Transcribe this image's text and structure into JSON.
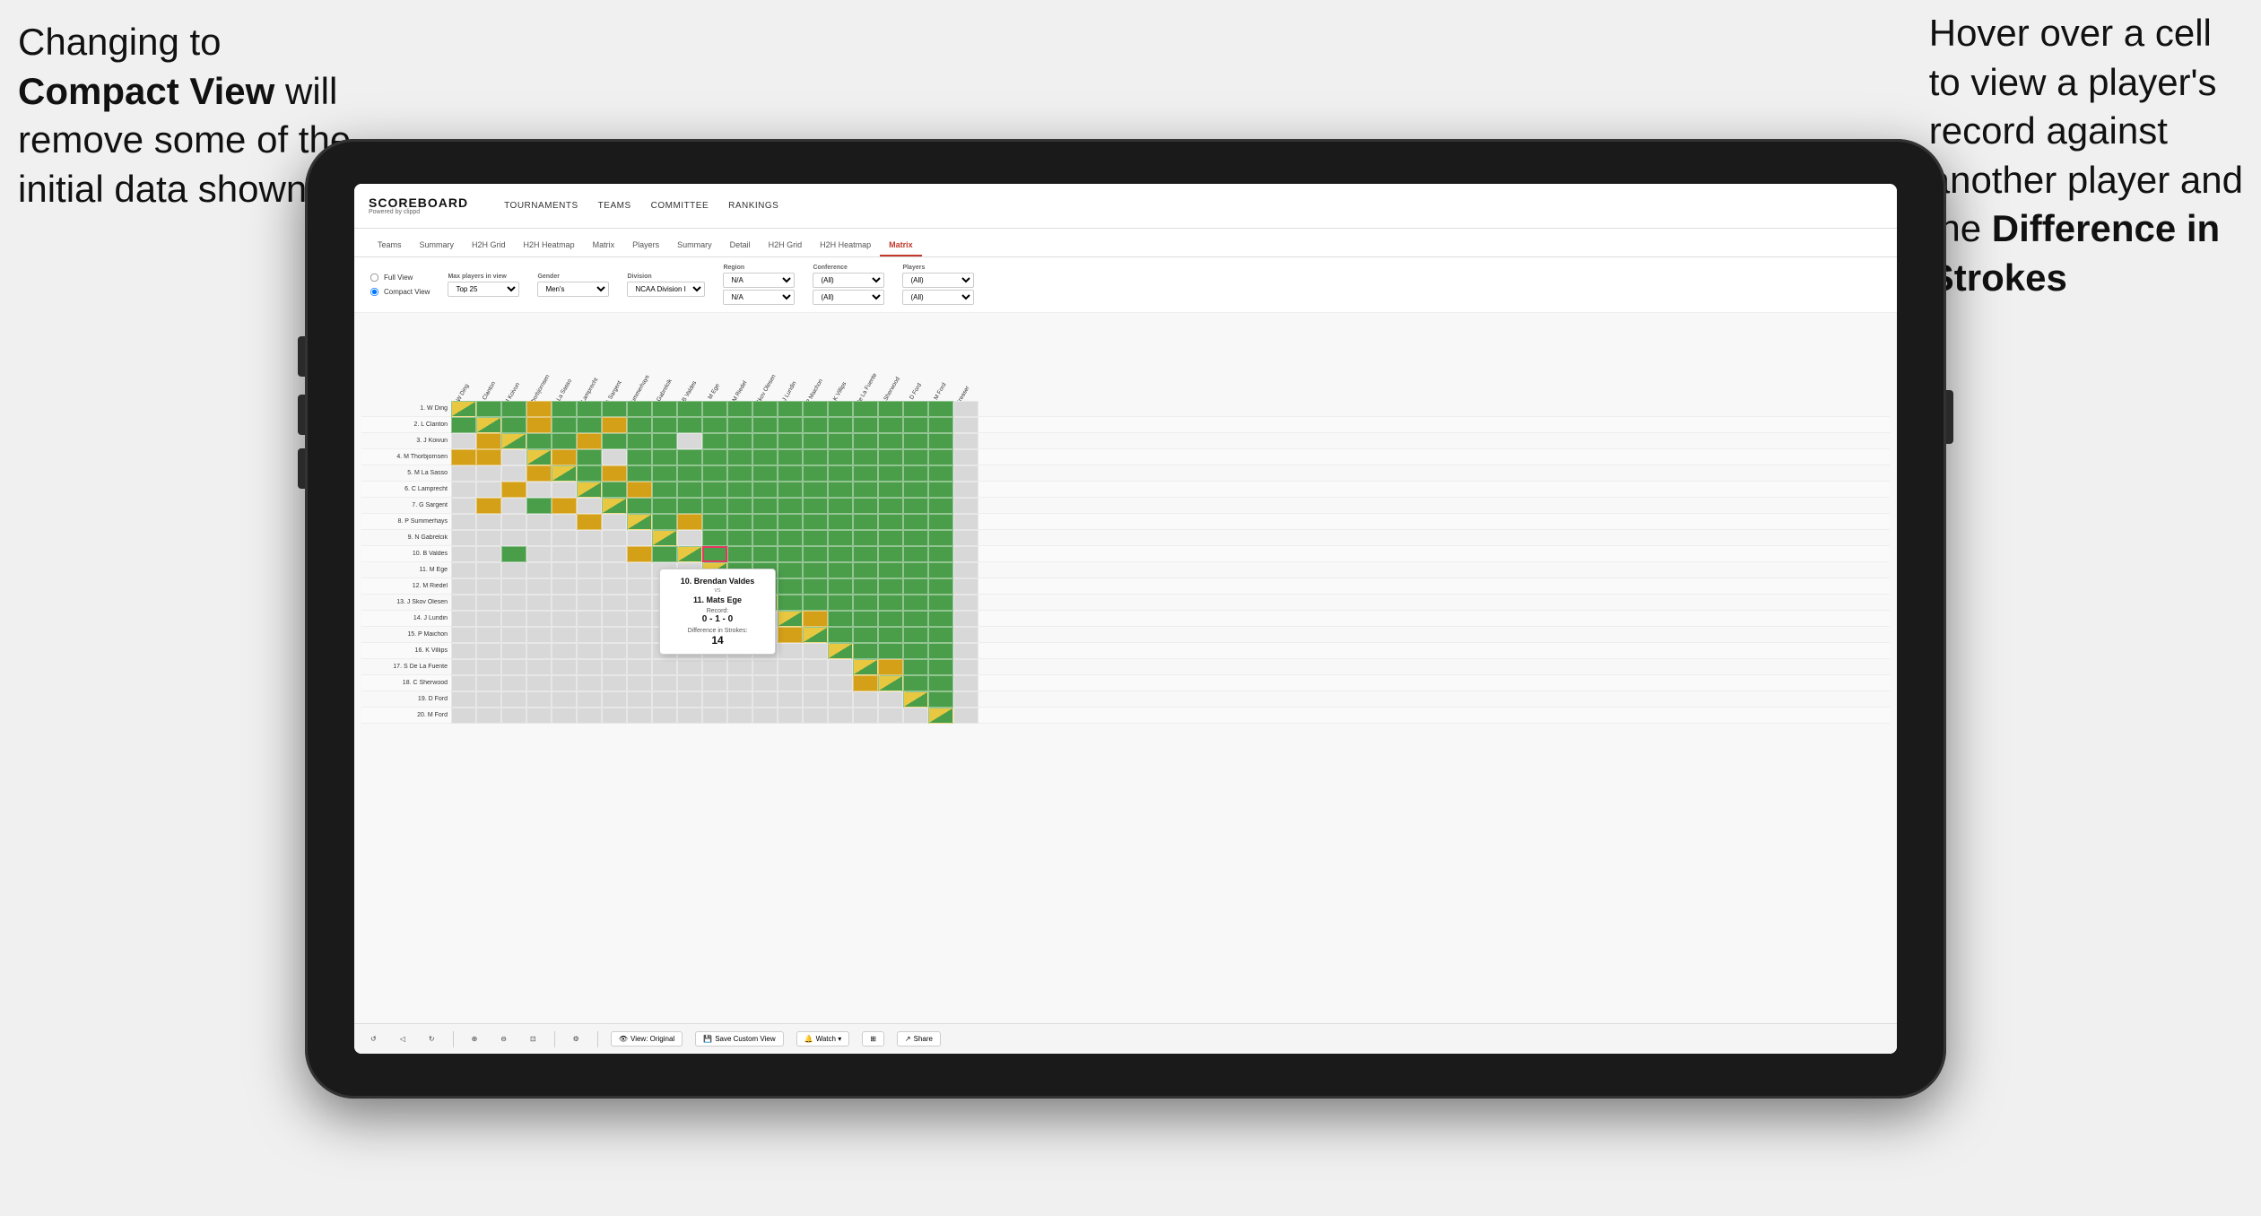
{
  "annotations": {
    "left": {
      "line1": "Changing to",
      "line2_bold": "Compact View",
      "line2_rest": " will",
      "line3": "remove some of the",
      "line4": "initial data shown"
    },
    "right": {
      "line1": "Hover over a cell",
      "line2": "to view a player's",
      "line3": "record against",
      "line4": "another player and",
      "line5_prefix": "the ",
      "line5_bold": "Difference in",
      "line6_bold": "Strokes"
    }
  },
  "nav": {
    "logo_main": "SCOREBOARD",
    "logo_sub": "Powered by clippd",
    "links": [
      "TOURNAMENTS",
      "TEAMS",
      "COMMITTEE",
      "RANKINGS"
    ]
  },
  "sub_nav": {
    "tabs": [
      "Teams",
      "Summary",
      "H2H Grid",
      "H2H Heatmap",
      "Matrix",
      "Players",
      "Summary",
      "Detail",
      "H2H Grid",
      "H2H Heatmap",
      "Matrix"
    ],
    "active_index": 10
  },
  "filters": {
    "view_options": [
      "Full View",
      "Compact View"
    ],
    "selected_view": "Compact View",
    "max_players_label": "Max players in view",
    "max_players_value": "Top 25",
    "gender_label": "Gender",
    "gender_value": "Men's",
    "division_label": "Division",
    "division_value": "NCAA Division I",
    "region_label": "Region",
    "region_values": [
      "N/A",
      "N/A"
    ],
    "conference_label": "Conference",
    "conference_values": [
      "(All)",
      "(All)"
    ],
    "players_label": "Players",
    "players_values": [
      "(All)",
      "(All)"
    ]
  },
  "matrix": {
    "col_headers": [
      "1. W Ding",
      "2. L Clanton",
      "3. J Koivun",
      "4. M Thorbjornsen",
      "5. M La Sasso",
      "6. C Lamprecht",
      "7. G Sargent",
      "8. P Summerhays",
      "9. N Gabrelcik",
      "10. B Valdes",
      "11. M Ege",
      "12. M Riedel",
      "13. J Skov Olesen",
      "14. J Lundin",
      "15. P Maichon",
      "16. K Villips",
      "17. S De La Fuente",
      "18. C Sherwood",
      "19. D Ford",
      "20. M Ford",
      "..."
    ],
    "rows": [
      {
        "label": "1. W Ding",
        "cells": [
          "",
          "G",
          "G",
          "Y",
          "G",
          "G",
          "G",
          "G",
          "G",
          "G",
          "G",
          "G",
          "G",
          "G",
          "G",
          "G",
          "G",
          "G",
          "G",
          "G"
        ]
      },
      {
        "label": "2. L Clanton",
        "cells": [
          "G",
          "",
          "G",
          "Y",
          "G",
          "G",
          "Y",
          "G",
          "G",
          "G",
          "G",
          "G",
          "G",
          "G",
          "G",
          "G",
          "G",
          "G",
          "G",
          "G"
        ]
      },
      {
        "label": "3. J Koivun",
        "cells": [
          "LG",
          "Y",
          "",
          "G",
          "G",
          "Y",
          "G",
          "G",
          "G",
          "LG",
          "G",
          "G",
          "G",
          "G",
          "G",
          "G",
          "G",
          "G",
          "G",
          "G"
        ]
      },
      {
        "label": "4. M Thorbjornsen",
        "cells": [
          "Y",
          "Y",
          "LG",
          "",
          "Y",
          "G",
          "LG",
          "G",
          "G",
          "G",
          "G",
          "G",
          "G",
          "G",
          "G",
          "G",
          "G",
          "G",
          "G",
          "G"
        ]
      },
      {
        "label": "5. M La Sasso",
        "cells": [
          "LG",
          "LG",
          "LG",
          "Y",
          "",
          "G",
          "Y",
          "G",
          "G",
          "G",
          "G",
          "G",
          "G",
          "G",
          "G",
          "G",
          "G",
          "G",
          "G",
          "G"
        ]
      },
      {
        "label": "6. C Lamprecht",
        "cells": [
          "LG",
          "LG",
          "Y",
          "LG",
          "LG",
          "",
          "G",
          "Y",
          "G",
          "G",
          "G",
          "G",
          "G",
          "G",
          "G",
          "G",
          "G",
          "G",
          "G",
          "G"
        ]
      },
      {
        "label": "7. G Sargent",
        "cells": [
          "LG",
          "Y",
          "LG",
          "G",
          "Y",
          "LG",
          "",
          "G",
          "G",
          "G",
          "G",
          "G",
          "G",
          "G",
          "G",
          "G",
          "G",
          "G",
          "G",
          "G"
        ]
      },
      {
        "label": "8. P Summerhays",
        "cells": [
          "LG",
          "LG",
          "LG",
          "LG",
          "LG",
          "Y",
          "LG",
          "",
          "G",
          "Y",
          "G",
          "G",
          "G",
          "G",
          "G",
          "G",
          "G",
          "G",
          "G",
          "G"
        ]
      },
      {
        "label": "9. N Gabrelcik",
        "cells": [
          "LG",
          "LG",
          "LG",
          "LG",
          "LG",
          "LG",
          "LG",
          "LG",
          "",
          "LG",
          "G",
          "G",
          "G",
          "G",
          "G",
          "G",
          "G",
          "G",
          "G",
          "G"
        ]
      },
      {
        "label": "10. B Valdes",
        "cells": [
          "LG",
          "LG",
          "G",
          "LG",
          "LG",
          "LG",
          "LG",
          "Y",
          "G",
          "",
          "G",
          "G",
          "G",
          "G",
          "G",
          "G",
          "G",
          "G",
          "G",
          "G"
        ]
      },
      {
        "label": "11. M Ege",
        "cells": [
          "LG",
          "LG",
          "LG",
          "LG",
          "LG",
          "LG",
          "LG",
          "LG",
          "LG",
          "LG",
          "",
          "G",
          "G",
          "G",
          "G",
          "G",
          "G",
          "G",
          "G",
          "G"
        ]
      },
      {
        "label": "12. M Riedel",
        "cells": [
          "LG",
          "LG",
          "LG",
          "LG",
          "LG",
          "LG",
          "LG",
          "LG",
          "LG",
          "LG",
          "LG",
          "",
          "G",
          "G",
          "G",
          "G",
          "G",
          "G",
          "G",
          "G"
        ]
      },
      {
        "label": "13. J Skov Olesen",
        "cells": [
          "LG",
          "LG",
          "LG",
          "LG",
          "LG",
          "LG",
          "LG",
          "LG",
          "LG",
          "LG",
          "LG",
          "LG",
          "",
          "G",
          "G",
          "G",
          "G",
          "G",
          "G",
          "G"
        ]
      },
      {
        "label": "14. J Lundin",
        "cells": [
          "LG",
          "LG",
          "LG",
          "LG",
          "LG",
          "LG",
          "LG",
          "LG",
          "LG",
          "LG",
          "LG",
          "LG",
          "LG",
          "",
          "Y",
          "G",
          "G",
          "G",
          "G",
          "G"
        ]
      },
      {
        "label": "15. P Maichon",
        "cells": [
          "LG",
          "LG",
          "LG",
          "LG",
          "LG",
          "LG",
          "LG",
          "LG",
          "LG",
          "LG",
          "LG",
          "LG",
          "LG",
          "Y",
          "",
          "G",
          "G",
          "G",
          "G",
          "G"
        ]
      },
      {
        "label": "16. K Villips",
        "cells": [
          "LG",
          "LG",
          "LG",
          "LG",
          "LG",
          "LG",
          "LG",
          "LG",
          "LG",
          "LG",
          "LG",
          "LG",
          "LG",
          "LG",
          "LG",
          "",
          "G",
          "G",
          "G",
          "G"
        ]
      },
      {
        "label": "17. S De La Fuente",
        "cells": [
          "LG",
          "LG",
          "LG",
          "LG",
          "LG",
          "LG",
          "LG",
          "LG",
          "LG",
          "LG",
          "LG",
          "LG",
          "LG",
          "LG",
          "LG",
          "LG",
          "",
          "Y",
          "G",
          "G"
        ]
      },
      {
        "label": "18. C Sherwood",
        "cells": [
          "LG",
          "LG",
          "LG",
          "LG",
          "LG",
          "LG",
          "LG",
          "LG",
          "LG",
          "LG",
          "LG",
          "LG",
          "LG",
          "LG",
          "LG",
          "LG",
          "Y",
          "",
          "G",
          "G"
        ]
      },
      {
        "label": "19. D Ford",
        "cells": [
          "LG",
          "LG",
          "LG",
          "LG",
          "LG",
          "LG",
          "LG",
          "LG",
          "LG",
          "LG",
          "LG",
          "LG",
          "LG",
          "LG",
          "LG",
          "LG",
          "LG",
          "LG",
          "",
          "G"
        ]
      },
      {
        "label": "20. M Ford",
        "cells": [
          "LG",
          "LG",
          "LG",
          "LG",
          "LG",
          "LG",
          "LG",
          "LG",
          "LG",
          "LG",
          "LG",
          "LG",
          "LG",
          "LG",
          "LG",
          "LG",
          "LG",
          "LG",
          "LG",
          ""
        ]
      }
    ]
  },
  "tooltip": {
    "player1": "10. Brendan Valdes",
    "vs": "vs",
    "player2": "11. Mats Ege",
    "record_label": "Record:",
    "record": "0 - 1 - 0",
    "diff_label": "Difference in Strokes:",
    "diff_value": "14"
  },
  "toolbar": {
    "undo": "↺",
    "redo": "↻",
    "view_original": "View: Original",
    "save_custom": "Save Custom View",
    "watch": "Watch ▾",
    "share": "Share"
  }
}
